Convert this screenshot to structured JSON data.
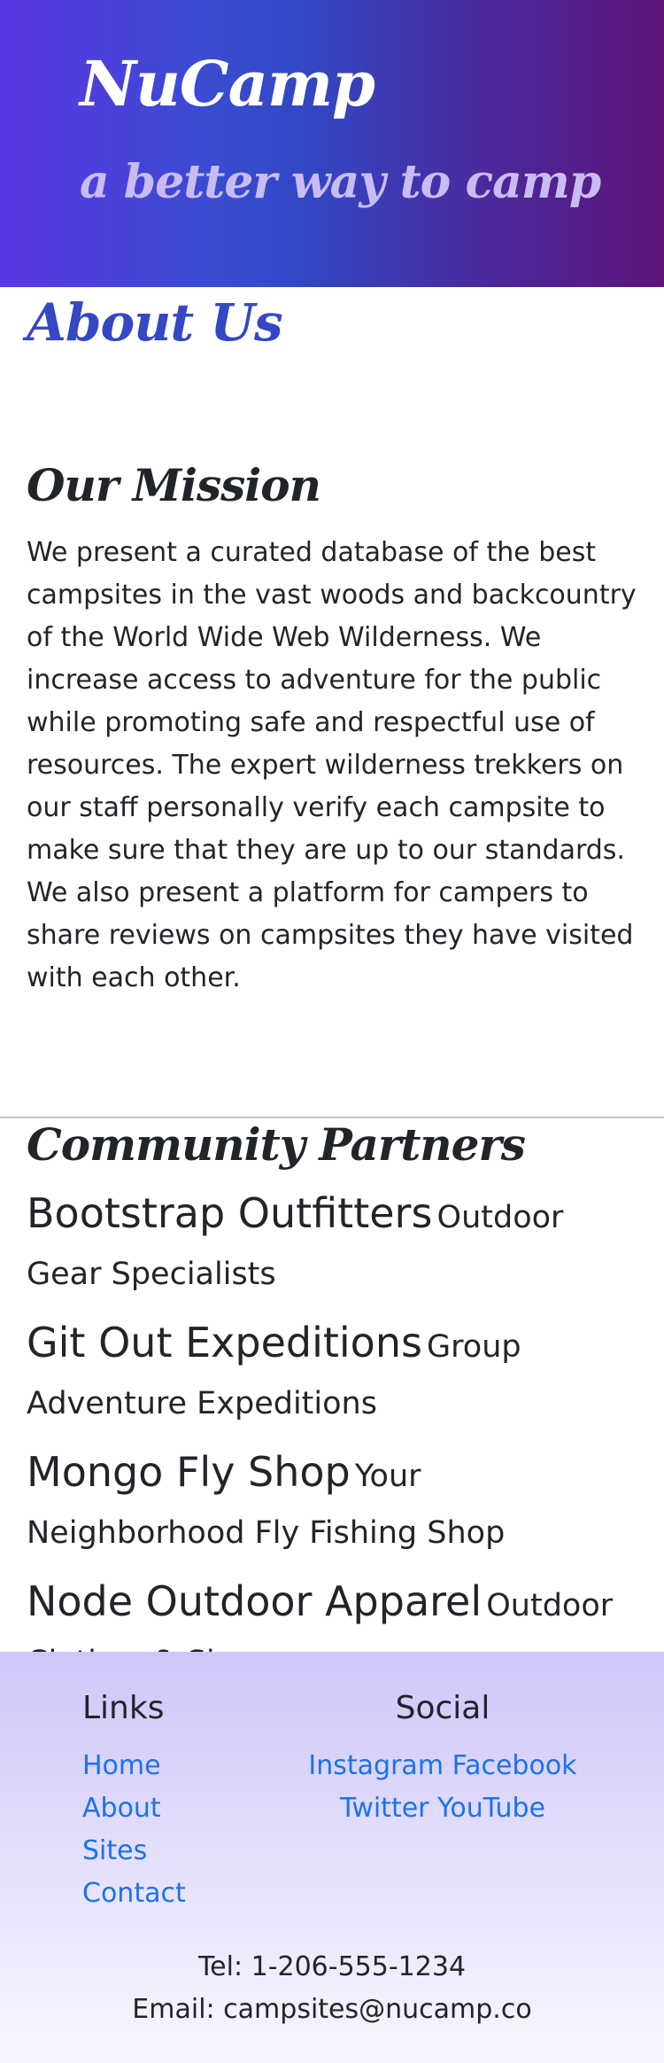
{
  "header": {
    "brand": "NuCamp",
    "tagline": "a better way to camp"
  },
  "main": {
    "title": "About Us",
    "mission": {
      "heading": "Our Mission",
      "text": "We present a curated database of the best campsites in the vast woods and backcountry of the World Wide Web Wilderness. We increase access to adventure for the public while promoting safe and respectful use of resources. The expert wilderness trekkers on our staff personally verify each campsite to make sure that they are up to our standards. We also present a platform for campers to share reviews on campsites they have visited with each other."
    },
    "partners": {
      "heading": "Community Partners",
      "items": [
        {
          "name": "Bootstrap Outfitters",
          "description": "Outdoor Gear Specialists"
        },
        {
          "name": "Git Out Expeditions",
          "description": "Group Adventure Expeditions"
        },
        {
          "name": "Mongo Fly Shop",
          "description": "Your Neighborhood Fly Fishing Shop"
        },
        {
          "name": "Node Outdoor Apparel",
          "description": "Outdoor Clothes & Shoes"
        }
      ]
    }
  },
  "footer": {
    "links": {
      "heading": "Links",
      "items": [
        "Home",
        "About",
        "Sites",
        "Contact"
      ]
    },
    "social": {
      "heading": "Social",
      "items": [
        "Instagram",
        "Facebook",
        "Twitter",
        "YouTube"
      ]
    },
    "contact": {
      "tel": "Tel: 1-206-555-1234",
      "email": "Email: campsites@nucamp.co"
    }
  },
  "colors": {
    "header_gradient_start": "#5a36e3",
    "header_gradient_end": "#5c1478",
    "about_title": "#3447c4",
    "tagline": "#c9bcf3",
    "link": "#1a73e8",
    "footer_top": "#cec6fa",
    "footer_bottom": "#f8f7ff"
  }
}
